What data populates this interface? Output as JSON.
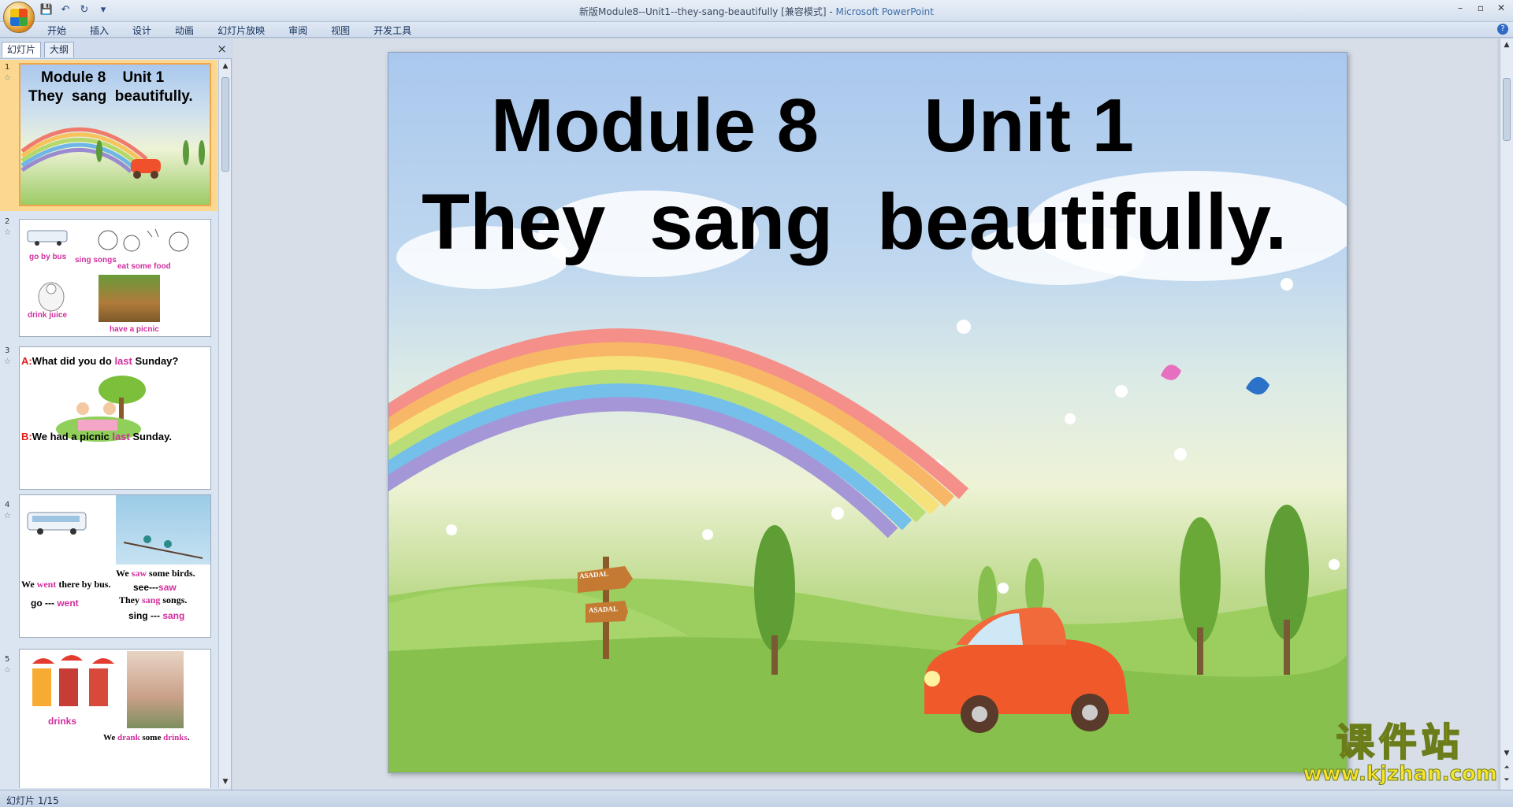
{
  "window": {
    "title_doc": "新版Module8--Unit1--they-sang-beautifully [兼容模式] - ",
    "title_app": "Microsoft PowerPoint"
  },
  "ribbon": {
    "tabs": [
      "开始",
      "插入",
      "设计",
      "动画",
      "幻灯片放映",
      "审阅",
      "视图",
      "开发工具"
    ]
  },
  "left_panel": {
    "tabs": [
      "幻灯片",
      "大纲"
    ],
    "close": "×"
  },
  "thumbnails": [
    {
      "number": "1",
      "title": "Module 8    Unit 1",
      "subtitle": "They  sang  beautifully."
    },
    {
      "number": "2",
      "labels": [
        "go by bus",
        "sing songs",
        "eat some food",
        "drink juice",
        "have a picnic"
      ]
    },
    {
      "number": "3",
      "a_prefix": "A:",
      "a_text1": "What did you do ",
      "a_last": "last",
      "a_text2": " Sunday?",
      "b_prefix": "B:",
      "b_text1": "We had a picnic ",
      "b_last": "last",
      "b_text2": " Sunday."
    },
    {
      "number": "4",
      "went_pre": "We ",
      "went": "went",
      "went_post": " there by bus.",
      "go_line_pre": "go --- ",
      "go_line_went": "went",
      "saw_pre": "We ",
      "saw": "saw",
      "saw_post": " some birds.",
      "see_pre": "see---",
      "see_saw": "saw",
      "sang_pre": "They ",
      "sang": "sang",
      "sang_post": " songs.",
      "sing_pre": "sing --- ",
      "sing_sang": "sang"
    },
    {
      "number": "5",
      "drinks": "drinks",
      "drank_pre": "We ",
      "drank": "drank",
      "drank_mid": " some ",
      "drank_drinks": "drinks",
      "drank_end": "."
    }
  ],
  "slide": {
    "title": "Module 8     Unit 1",
    "subtitle": "They  sang  beautifully.",
    "sign_top": "ASADAL",
    "sign_bottom": "ASADAL"
  },
  "status": {
    "text": "幻灯片 1/15"
  },
  "watermark": {
    "cn": "课件站",
    "url": "www.kjzhan.com"
  }
}
